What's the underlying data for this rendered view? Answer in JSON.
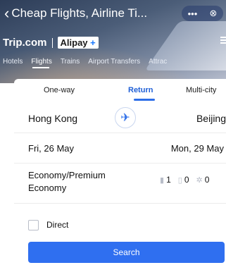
{
  "window": {
    "title": "Cheap Flights, Airline Ti...",
    "more_icon": "more-dots-icon",
    "close_icon": "close-circle-icon"
  },
  "brand": {
    "trip": "Trip.com",
    "alipay": "Alipay",
    "plus": "+"
  },
  "nav": {
    "tabs": [
      "Hotels",
      "Flights",
      "Trains",
      "Airport Transfers",
      "Attrac"
    ],
    "active": "Flights"
  },
  "trip_type": {
    "tabs": [
      "One-way",
      "Return",
      "Multi-city"
    ],
    "active": "Return"
  },
  "route": {
    "from": "Hong Kong",
    "to": "Beijing",
    "swap_icon": "plane-icon"
  },
  "dates": {
    "depart": "Fri, 26 May",
    "return": "Mon, 29 May"
  },
  "cabin": {
    "label": "Economy/Premium Economy"
  },
  "passengers": {
    "adults": "1",
    "children": "0",
    "infants": "0"
  },
  "options": {
    "direct_label": "Direct",
    "direct_checked": false
  },
  "actions": {
    "search_label": "Search"
  },
  "colors": {
    "accent": "#2f6ff0",
    "active_tab": "#1f5fd6"
  }
}
